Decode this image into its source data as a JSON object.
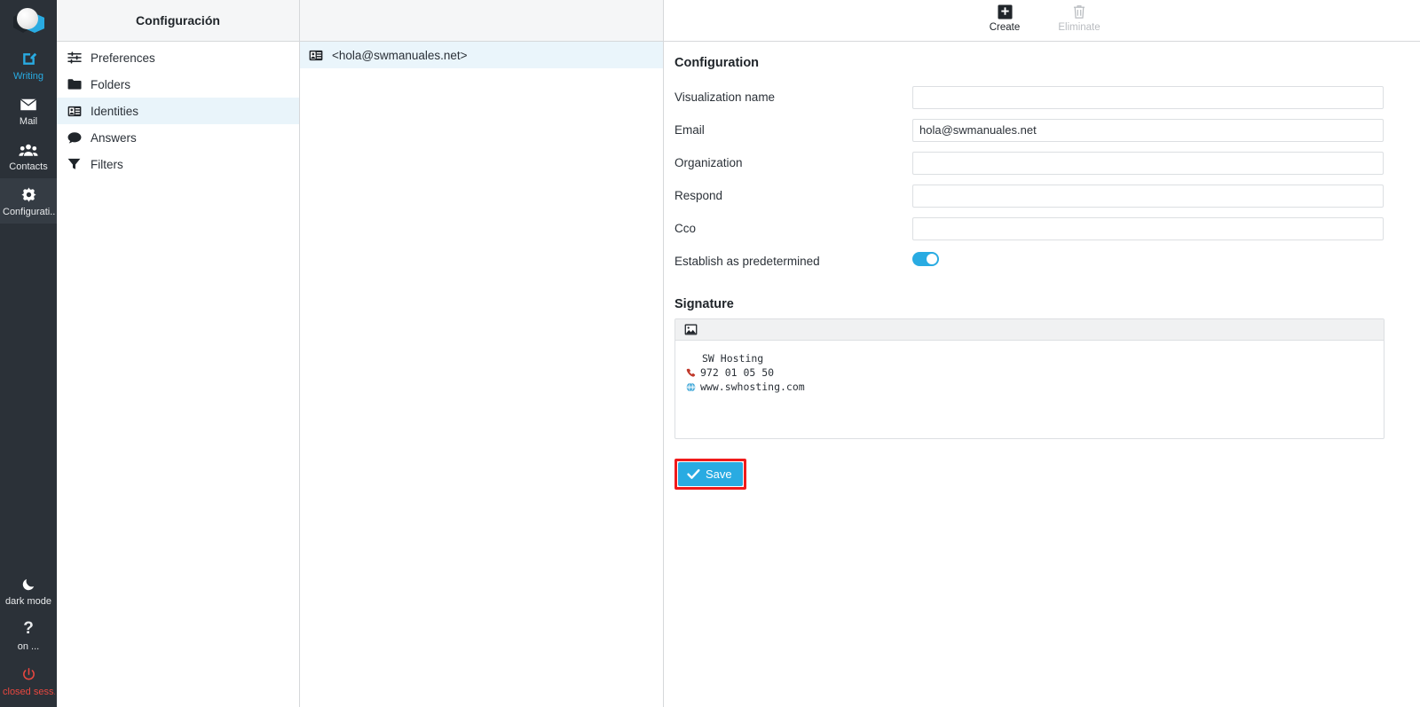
{
  "colors": {
    "accent": "#29abe2",
    "rail_bg": "#2b3138",
    "rail_active_bg": "#353c44",
    "danger": "#e8473f",
    "highlight_box": "#f01b1b",
    "selected_row": "#e9f4fa"
  },
  "rail": {
    "logo_name": "app-logo",
    "items": [
      {
        "icon": "compose-icon",
        "label": "Writing",
        "state": "accent"
      },
      {
        "icon": "envelope-icon",
        "label": "Mail",
        "state": "normal"
      },
      {
        "icon": "contacts-icon",
        "label": "Contacts",
        "state": "normal"
      },
      {
        "icon": "gear-icon",
        "label": "Configurati...",
        "state": "active"
      }
    ],
    "bottom_items": [
      {
        "icon": "moon-icon",
        "label": "dark mode",
        "state": "normal"
      },
      {
        "icon": "question-icon",
        "label": "on ...",
        "state": "normal"
      },
      {
        "icon": "power-icon",
        "label": "closed sess...",
        "state": "danger"
      }
    ]
  },
  "settings_panel": {
    "title": "Configuración",
    "items": [
      {
        "icon": "sliders-icon",
        "label": "Preferences",
        "selected": false
      },
      {
        "icon": "folder-icon",
        "label": "Folders",
        "selected": false
      },
      {
        "icon": "id-card-icon",
        "label": "Identities",
        "selected": true
      },
      {
        "icon": "speech-bubble-icon",
        "label": "Answers",
        "selected": false
      },
      {
        "icon": "funnel-icon",
        "label": "Filters",
        "selected": false
      }
    ]
  },
  "identities_panel": {
    "items": [
      {
        "icon": "id-card-icon",
        "label": "<hola@swmanuales.net>",
        "selected": true
      }
    ]
  },
  "toolbar": {
    "create_label": "Create",
    "eliminate_label": "Eliminate",
    "create_icon": "plus-square-icon",
    "eliminate_icon": "trash-icon"
  },
  "main": {
    "section_title": "Configuration",
    "fields": [
      {
        "label": "Visualization name",
        "value": "",
        "placeholder": ""
      },
      {
        "label": "Email",
        "value": "hola@swmanuales.net",
        "placeholder": ""
      },
      {
        "label": "Organization",
        "value": "",
        "placeholder": ""
      },
      {
        "label": "Respond",
        "value": "",
        "placeholder": ""
      },
      {
        "label": "Cco",
        "value": "",
        "placeholder": ""
      }
    ],
    "toggle": {
      "label": "Establish as predetermined",
      "on": true
    },
    "signature": {
      "title": "Signature",
      "toolbar_icon": "insert-image-icon",
      "lines": [
        {
          "icon": "",
          "text": "SW Hosting"
        },
        {
          "icon": "phone-icon",
          "text": "972 01 05 50"
        },
        {
          "icon": "globe-icon",
          "text": "www.swhosting.com"
        }
      ]
    },
    "save": {
      "label": "Save",
      "icon": "check-icon",
      "highlighted": true
    }
  }
}
